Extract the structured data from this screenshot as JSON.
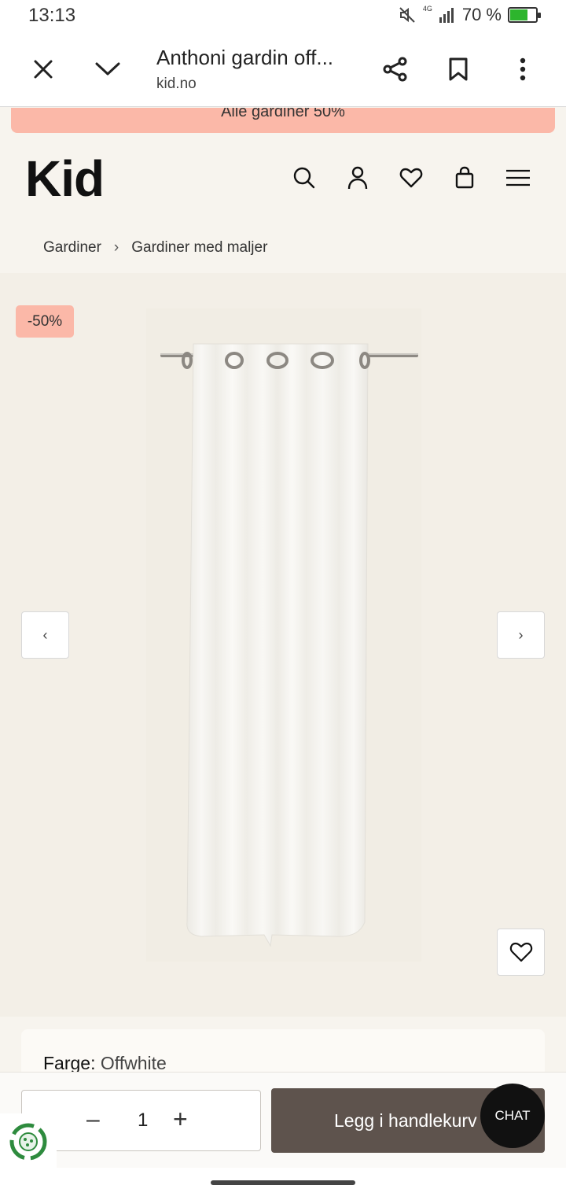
{
  "status_bar": {
    "time": "13:13",
    "network": "4G",
    "battery_percent": "70 %",
    "battery_level": 0.7
  },
  "browser": {
    "page_title": "Anthoni gardin off...",
    "url": "kid.no"
  },
  "promo_banner": {
    "text": "Alle gardiner 50%"
  },
  "site_header": {
    "logo": "Kid",
    "icons": [
      "search-icon",
      "account-icon",
      "wishlist-icon",
      "bag-icon",
      "menu-icon"
    ]
  },
  "breadcrumb": {
    "items": [
      "Gardiner",
      "Gardiner med maljer"
    ],
    "separator": "›"
  },
  "product": {
    "discount_badge": "-50%",
    "prev_arrow": "‹",
    "next_arrow": "›",
    "color_label": "Farge:",
    "color_value": "Offwhite"
  },
  "purchase": {
    "quantity": "1",
    "minus": "–",
    "plus": "+",
    "add_to_cart_label": "Legg i handlekurv",
    "chat_label": "CHAT"
  },
  "colors": {
    "promo": "#fbb8a8",
    "add_button": "#5e534d",
    "background": "#f7f4ee"
  }
}
